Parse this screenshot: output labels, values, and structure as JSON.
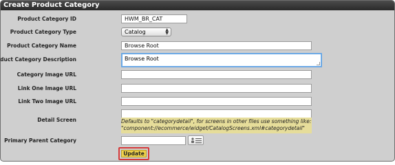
{
  "window": {
    "title": "Create Product Category"
  },
  "form": {
    "product_category_id": {
      "label": "Product Category ID",
      "value": "HWM_BR_CAT"
    },
    "product_category_type": {
      "label": "Product Category Type",
      "selected": "Catalog"
    },
    "product_category_name": {
      "label": "Product Category Name",
      "value": "Browse Root"
    },
    "product_category_description": {
      "label": "Product Category Description",
      "value": "Browse Root"
    },
    "category_image_url": {
      "label": "Category Image URL",
      "value": ""
    },
    "link_one_image_url": {
      "label": "Link One Image URL",
      "value": ""
    },
    "link_two_image_url": {
      "label": "Link Two Image URL",
      "value": ""
    },
    "detail_screen": {
      "label": "Detail Screen",
      "value": "",
      "hint_line1": "Defaults to \"categorydetail\", for screens in other files use something like:",
      "hint_line2": "\"component://ecommerce/widget/CatalogScreens.xml#categorydetail\""
    },
    "primary_parent_category": {
      "label": "Primary Parent Category",
      "value": ""
    },
    "update_button": {
      "label": "Update"
    }
  },
  "colors": {
    "panel_bg": "#cfcfcf",
    "title_bg": "#2f2f2f",
    "hint_bg": "#e6dd9a",
    "update_button": "#f1d34a",
    "highlight_border": "#d63a3a",
    "focus_border": "#6aa8e6"
  }
}
